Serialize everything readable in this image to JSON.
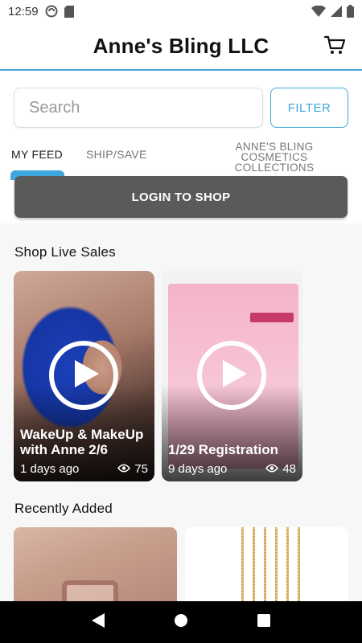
{
  "status_bar": {
    "time": "12:59"
  },
  "header": {
    "title": "Anne's Bling LLC"
  },
  "search": {
    "placeholder": "Search",
    "filter_label": "FILTER"
  },
  "tabs": [
    {
      "label": "MY FEED",
      "active": true
    },
    {
      "label": "SHIP/SAVE",
      "active": false
    },
    {
      "label": "ANNE'S BLING COSMETICS COLLECTIONS",
      "active": false
    }
  ],
  "login_button": "LOGIN TO SHOP",
  "live_sales": {
    "title": "Shop Live Sales",
    "cards": [
      {
        "title": "WakeUp & MakeUp with Anne 2/6",
        "age": "1 days ago",
        "views": "75"
      },
      {
        "title": "1/29 Registration",
        "age": "9 days ago",
        "views": "48"
      }
    ]
  },
  "recently_added": {
    "title": "Recently Added"
  },
  "colors": {
    "accent": "#3fa7dd",
    "header_border": "#4aa6d8",
    "login_button_bg": "#5a5a5a"
  },
  "icons": {
    "cart": "cart-icon",
    "play": "play-icon",
    "views": "eye-icon"
  }
}
